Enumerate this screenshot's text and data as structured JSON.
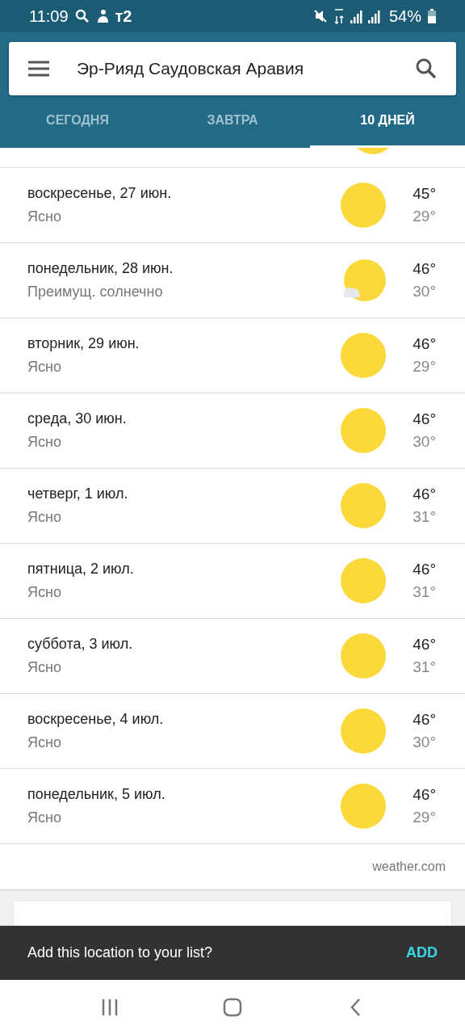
{
  "status_bar": {
    "time": "11:09",
    "carrier": "т2",
    "battery": "54%"
  },
  "search": {
    "value": "Эр-Рияд Саудовская Аравия"
  },
  "tabs": [
    {
      "label": "СЕГОДНЯ",
      "selected": false
    },
    {
      "label": "ЗАВТРА",
      "selected": false
    },
    {
      "label": "10 ДНЕЙ",
      "selected": true
    }
  ],
  "days": [
    {
      "date": "воскресенье, 27 июн.",
      "condition": "Ясно",
      "high": "45°",
      "low": "29°",
      "kind": "sunny"
    },
    {
      "date": "понедельник, 28 июн.",
      "condition": "Преимущ. солнечно",
      "high": "46°",
      "low": "30°",
      "kind": "mostly_sunny"
    },
    {
      "date": "вторник, 29 июн.",
      "condition": "Ясно",
      "high": "46°",
      "low": "29°",
      "kind": "sunny"
    },
    {
      "date": "среда, 30 июн.",
      "condition": "Ясно",
      "high": "46°",
      "low": "30°",
      "kind": "sunny"
    },
    {
      "date": "четверг, 1 июл.",
      "condition": "Ясно",
      "high": "46°",
      "low": "31°",
      "kind": "sunny"
    },
    {
      "date": "пятница, 2 июл.",
      "condition": "Ясно",
      "high": "46°",
      "low": "31°",
      "kind": "sunny"
    },
    {
      "date": "суббота, 3 июл.",
      "condition": "Ясно",
      "high": "46°",
      "low": "31°",
      "kind": "sunny"
    },
    {
      "date": "воскресенье, 4 июл.",
      "condition": "Ясно",
      "high": "46°",
      "low": "30°",
      "kind": "sunny"
    },
    {
      "date": "понедельник, 5 июл.",
      "condition": "Ясно",
      "high": "46°",
      "low": "29°",
      "kind": "sunny"
    }
  ],
  "source": "weather.com",
  "snackbar": {
    "message": "Add this location to your list?",
    "action": "ADD"
  }
}
